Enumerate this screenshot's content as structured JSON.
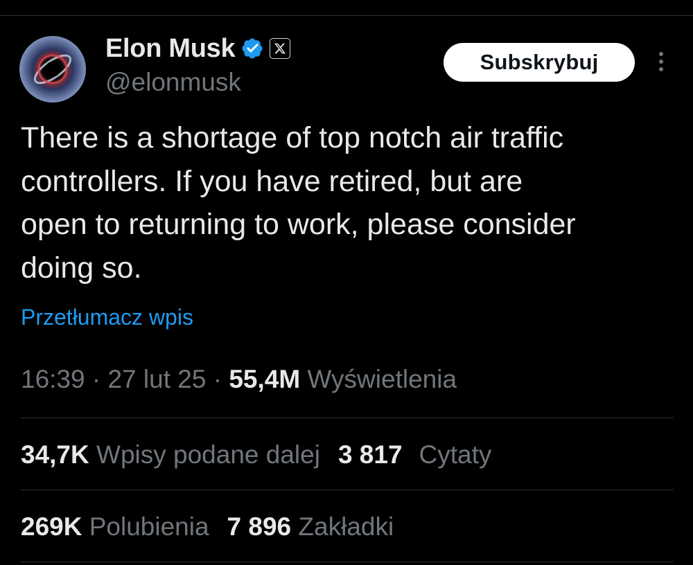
{
  "author": {
    "name": "Elon Musk",
    "handle": "@elonmusk",
    "verified_icon": "verified-badge-icon",
    "affiliation_icon": "x-logo-icon"
  },
  "header": {
    "subscribe_label": "Subskrybuj",
    "more_icon": "more-vertical-icon"
  },
  "tweet": {
    "text": "There is a shortage of top notch air traffic\ncontrollers. If you have retired, but are\nopen to returning to work, please consider\ndoing so.",
    "translate_label": "Przetłumacz wpis"
  },
  "meta": {
    "time": "16:39",
    "separator": "·",
    "date": "27 lut 25",
    "views_count": "55,4M",
    "views_label": "Wyświetlenia"
  },
  "stats": {
    "reposts_count": "34,7K",
    "reposts_label": "Wpisy podane dalej",
    "quotes_count": "3 817",
    "quotes_label": "Cytaty",
    "likes_count": "269K",
    "likes_label": "Polubienia",
    "bookmarks_count": "7 896",
    "bookmarks_label": "Zakładki"
  },
  "colors": {
    "background": "#000000",
    "text": "#e7e9ea",
    "muted": "#71767b",
    "link": "#1d9bf0",
    "verified": "#1d9bf0",
    "divider": "#2f3336"
  }
}
